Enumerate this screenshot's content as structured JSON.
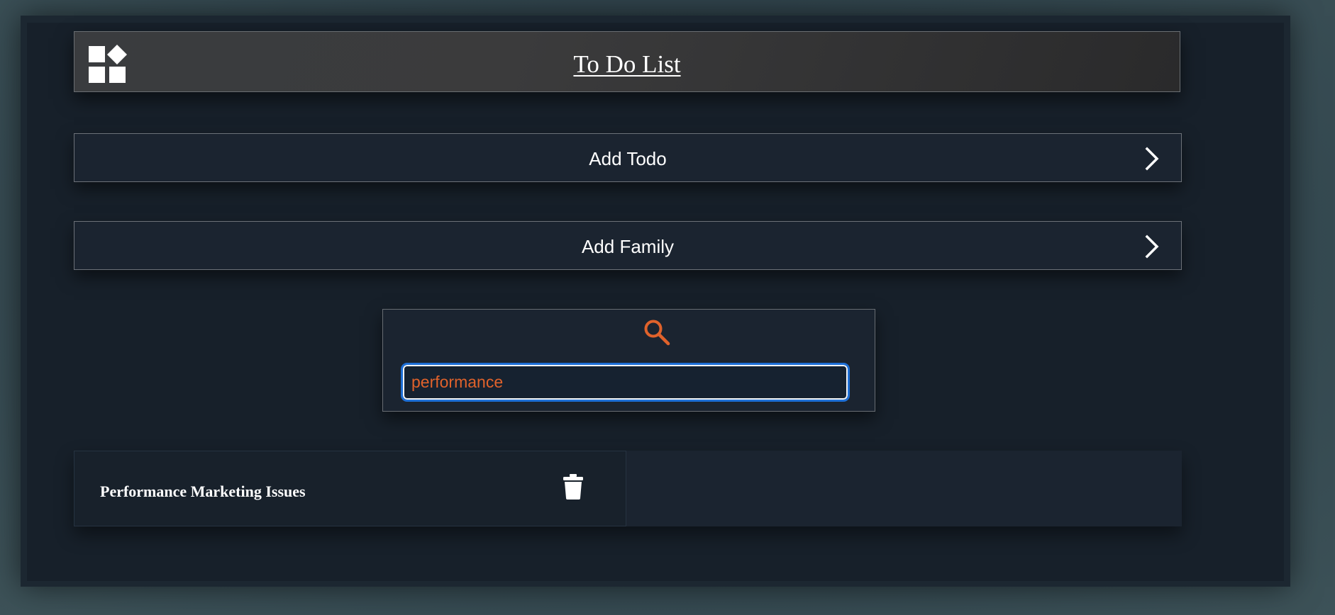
{
  "header": {
    "title": "To Do List",
    "logo_icon": "widgets-icon"
  },
  "actions": {
    "add_todo_label": "Add Todo",
    "add_family_label": "Add Family",
    "chevron_icon": "chevron-right-icon"
  },
  "search": {
    "icon": "search-icon",
    "value": "performance",
    "accent_color": "#e0622b"
  },
  "todos": [
    {
      "title": "Performance Marketing Issues",
      "delete_icon": "trash-icon"
    }
  ],
  "colors": {
    "background": "#17202a",
    "accent": "#e0622b",
    "focus_ring": "#1e6fd6"
  }
}
